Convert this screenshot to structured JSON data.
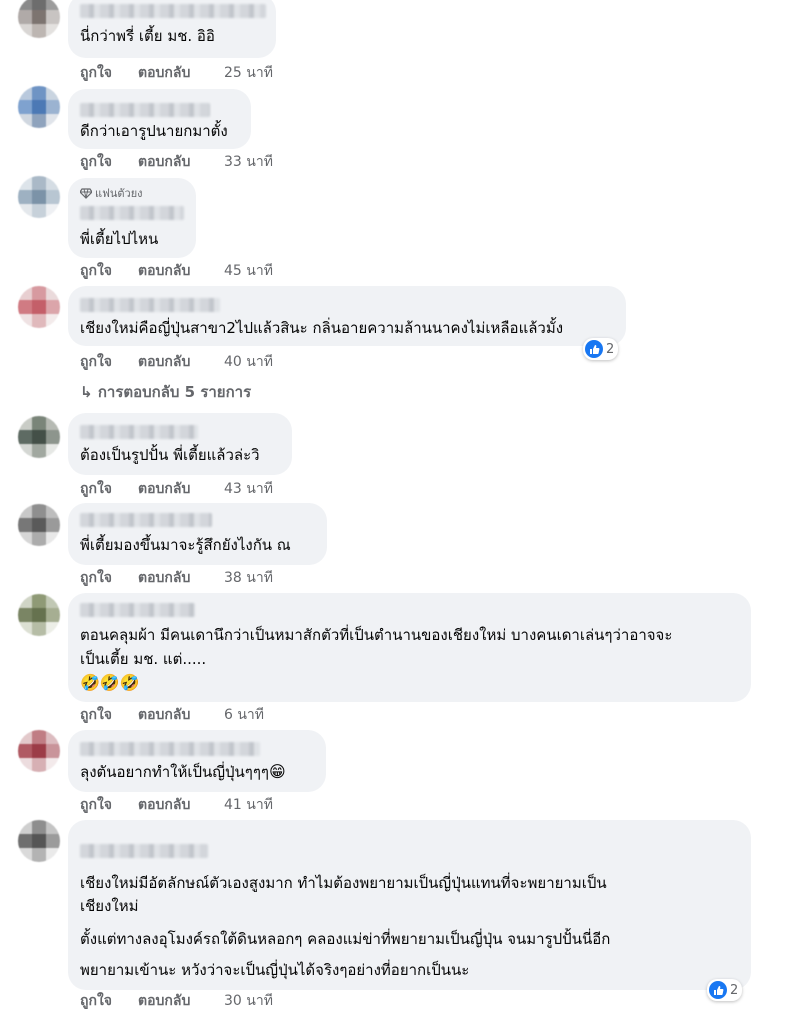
{
  "comments": [
    {
      "text": [
        "นี่กว่าพรี่ เตี้ย มช. อิอิ"
      ],
      "like": "ถูกใจ",
      "reply": "ตอบกลับ",
      "time": "25 นาที"
    },
    {
      "text": [
        "ดีกว่าเอารูปนายกมาตั้ง"
      ],
      "like": "ถูกใจ",
      "reply": "ตอบกลับ",
      "time": "33 นาที"
    },
    {
      "badge": "แฟนตัวยง",
      "text": [
        "พี่เตี้ยไปไหน"
      ],
      "like": "ถูกใจ",
      "reply": "ตอบกลับ",
      "time": "45 นาที"
    },
    {
      "text": [
        "เชียงใหม่คือญี่ปุ่นสาขา2ไปแล้วสินะ กลิ่นอายความล้านนาคงไม่เหลือแล้วมั้ง"
      ],
      "like": "ถูกใจ",
      "reply": "ตอบกลับ",
      "time": "40 นาที",
      "reaction_count": "2"
    },
    {
      "text": [
        "ต้องเป็นรูปปั้น พี่เตี้ยแล้วล่ะวิ"
      ],
      "like": "ถูกใจ",
      "reply": "ตอบกลับ",
      "time": "43 นาที"
    },
    {
      "text": [
        "พี่เตี้ยมองขึ้นมาจะรู้สึกยังไงกัน ณ"
      ],
      "like": "ถูกใจ",
      "reply": "ตอบกลับ",
      "time": "38 นาที"
    },
    {
      "text": [
        "ตอนคลุมผ้า มีคนเดานึกว่าเป็นหมาสักตัวที่เป็นตำนานของเชียงใหม่ บางคนเดาเล่นๆว่าอาจจะ",
        "เป็นเตี้ย มช. แต่....."
      ],
      "emoji": "🤣🤣🤣",
      "like": "ถูกใจ",
      "reply": "ตอบกลับ",
      "time": "6 นาที"
    },
    {
      "text": [
        "ลุงตันอยากทำให้เป็นญี่ปุ่นๆๆๆ"
      ],
      "emoji": "😁",
      "like": "ถูกใจ",
      "reply": "ตอบกลับ",
      "time": "41 นาที"
    },
    {
      "text": [
        "เชียงใหม่มีอัตลักษณ์ตัวเองสูงมาก ทำไมต้องพยายามเป็นญี่ปุ่นแทนที่จะพยายามเป็น",
        "เชียงใหม่",
        "ตั้งแต่ทางลงอุโมงค์รถใต้ดินหลอกๆ คลองแม่ข่าที่พยายามเป็นญี่ปุ่น จนมารูปปั้นนี่อีก",
        "พยายามเข้านะ หวังว่าจะเป็นญี่ปุ่นได้จริงๆอย่างที่อยากเป็นนะ"
      ],
      "like": "ถูกใจ",
      "reply": "ตอบกลับ",
      "time": "30 นาที",
      "reaction_count": "2"
    }
  ],
  "replies_link": "การตอบกลับ 5 รายการ",
  "colors": {
    "bubble": "#f0f2f5",
    "meta": "#65676b",
    "like_blue": "#1877f2"
  }
}
